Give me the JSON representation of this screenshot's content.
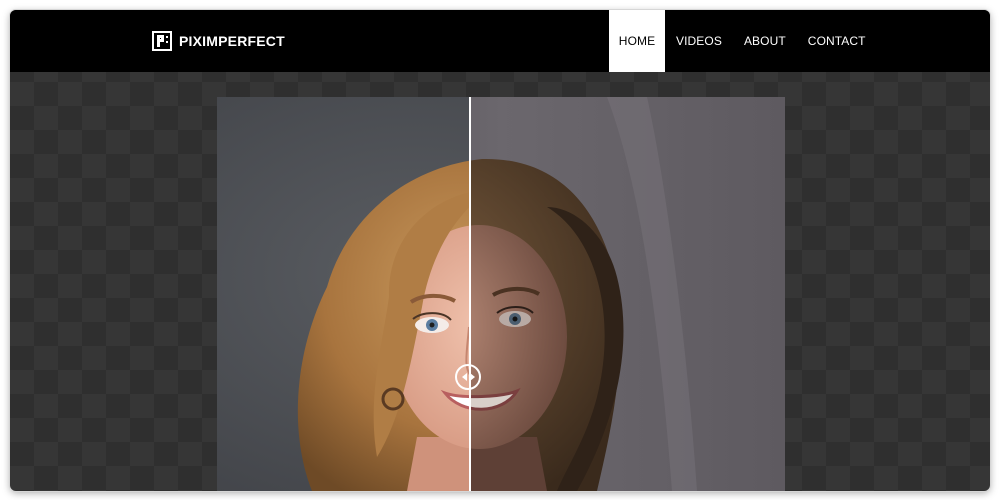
{
  "brand": {
    "name": "PIXIMPERFECT",
    "logo_icon": "pi-logo-icon"
  },
  "nav": {
    "items": [
      {
        "label": "HOME",
        "active": true
      },
      {
        "label": "VIDEOS",
        "active": false
      },
      {
        "label": "ABOUT",
        "active": false
      },
      {
        "label": "CONTACT",
        "active": false
      }
    ]
  },
  "comparison": {
    "type": "before-after-slider",
    "slider_position": 0.45,
    "handle_icon": "left-right-arrows-icon",
    "subject": "portrait of smiling woman with wavy blonde hair"
  },
  "colors": {
    "nav_background": "#000000",
    "nav_text": "#ffffff",
    "active_tab_background": "#ffffff",
    "active_tab_text": "#000000",
    "page_background_checker_a": "#2f2f2f",
    "page_background_checker_b": "#363636"
  }
}
